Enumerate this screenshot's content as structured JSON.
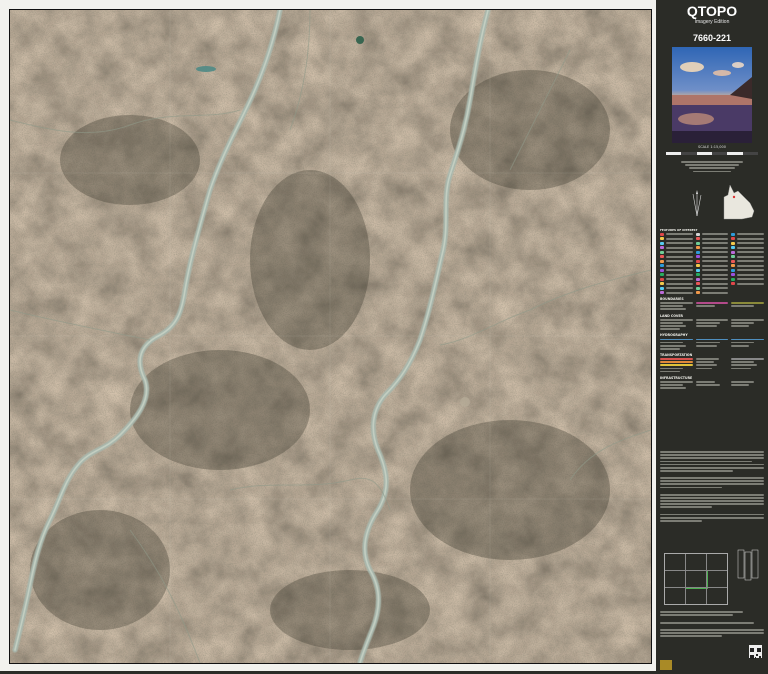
{
  "panel": {
    "title": "QTOPO",
    "subtitle": "Imagery Edition",
    "sheet_number": "7660-221",
    "scale_text": "SCALE 1:15,000",
    "legend_headers": [
      "FEATURES OF INTEREST",
      "BOUNDARIES",
      "LAND COVER",
      "HYDROGRAPHY",
      "TRANSPORTATION",
      "INFRASTRUCTURE"
    ]
  },
  "colors": {
    "panel_bg": "#2b2c27",
    "terrain": "#6e5b47",
    "river": "#9fb6b4"
  }
}
